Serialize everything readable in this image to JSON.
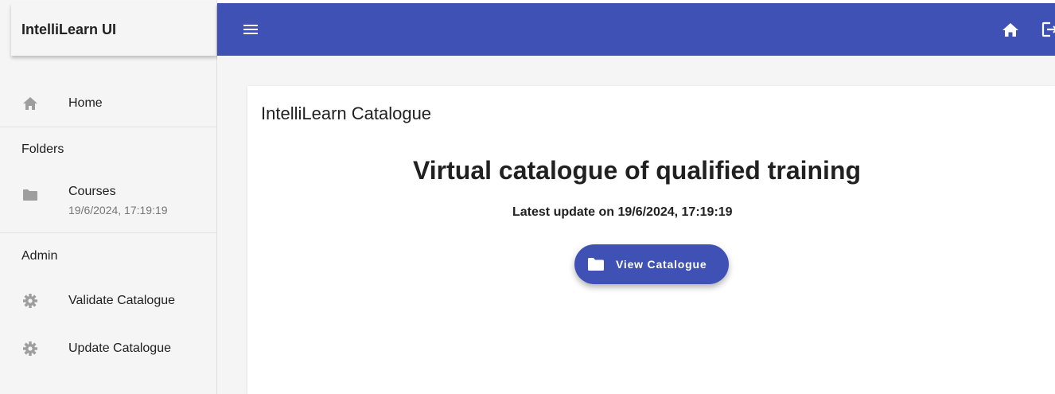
{
  "app": {
    "title": "IntelliLearn UI"
  },
  "colors": {
    "primary": "#3f51b5",
    "sidebar_bg": "#f5f5f5",
    "icon_grey": "#9e9e9e"
  },
  "topbar": {
    "icons": [
      "menu-icon",
      "home-icon",
      "logout-icon"
    ]
  },
  "sidebar": {
    "home": {
      "label": "Home",
      "icon": "home-icon"
    },
    "folders_section": "Folders",
    "courses": {
      "label": "Courses",
      "subtitle": "19/6/2024, 17:19:19",
      "icon": "folder-icon"
    },
    "admin_section": "Admin",
    "validate": {
      "label": "Validate Catalogue",
      "icon": "gear-icon"
    },
    "update": {
      "label": "Update Catalogue",
      "icon": "gear-icon"
    }
  },
  "main": {
    "card_title": "IntelliLearn Catalogue",
    "headline": "Virtual catalogue of qualified training",
    "update_text": "Latest update on 19/6/2024, 17:19:19",
    "button": {
      "label": "View Catalogue",
      "icon": "folder-icon"
    }
  }
}
